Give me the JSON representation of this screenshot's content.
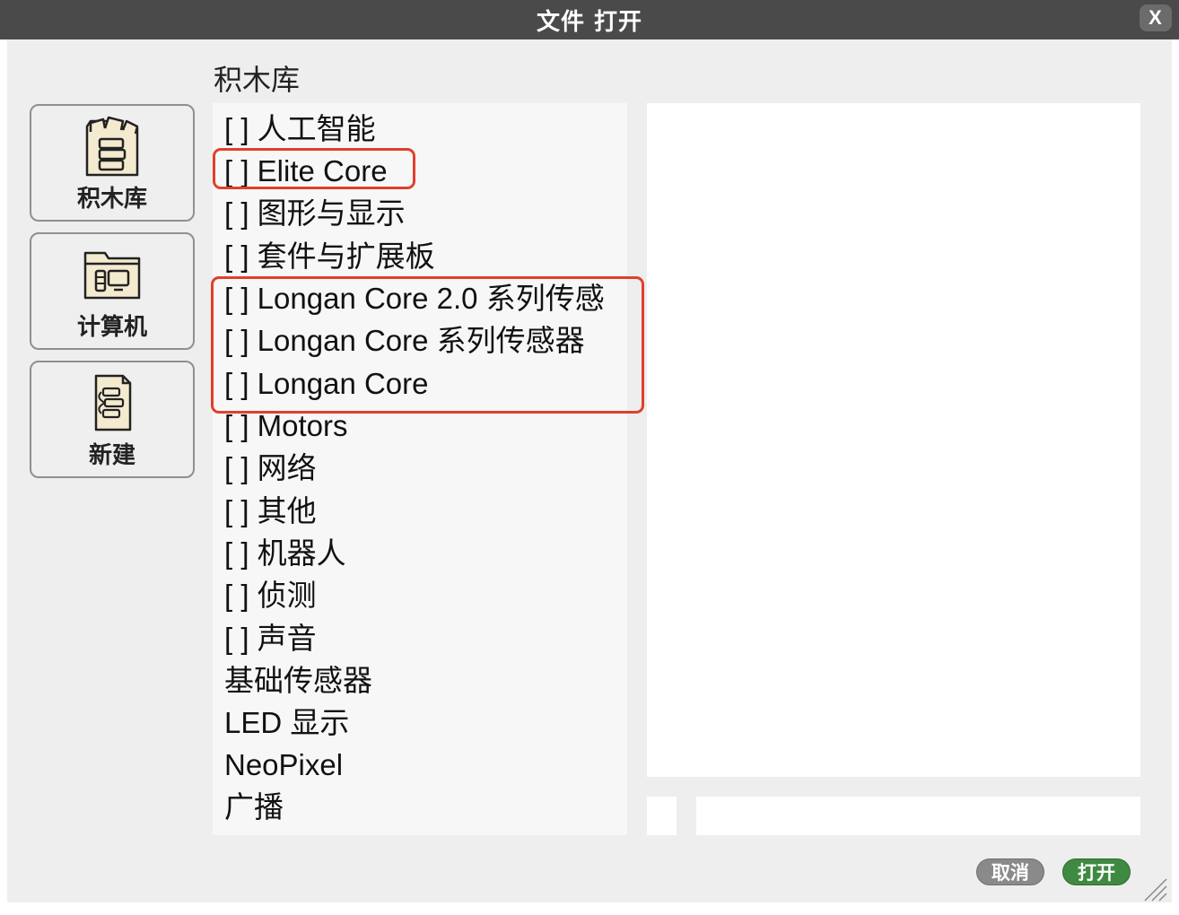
{
  "window": {
    "title": "文件 打开",
    "close_label": "X"
  },
  "nav": [
    {
      "id": "library",
      "label": "积木库",
      "icon": "blocks-library-icon"
    },
    {
      "id": "computer",
      "label": "计算机",
      "icon": "folder-computer-icon"
    },
    {
      "id": "new",
      "label": "新建",
      "icon": "new-document-icon"
    }
  ],
  "section_title": "积木库",
  "libraries": [
    "[ ] 人工智能",
    "[ ] Elite Core",
    "[ ] 图形与显示",
    "[ ] 套件与扩展板",
    "[ ] Longan Core 2.0 系列传感",
    "[ ] Longan Core 系列传感器",
    "[ ] Longan Core",
    "[ ] Motors",
    "[ ] 网络",
    "[ ] 其他",
    "[ ] 机器人",
    "[ ] 侦测",
    "[ ] 声音",
    "基础传感器",
    "LED 显示",
    "NeoPixel",
    "广播"
  ],
  "highlight_color": "#e0402c",
  "filename_value": "",
  "buttons": {
    "cancel": "取消",
    "open": "打开"
  },
  "colors": {
    "titlebar": "#4a4a4a",
    "open_button": "#3f8a42",
    "cancel_button": "#8a8a8a"
  }
}
